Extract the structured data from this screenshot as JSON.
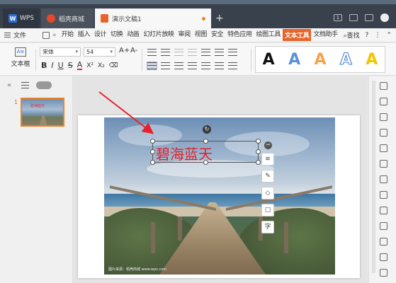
{
  "titlebar": {
    "tabs": [
      {
        "label": "WPS",
        "logo": "W"
      },
      {
        "label": "稻壳商城"
      },
      {
        "label": "演示文稿1"
      }
    ],
    "badge": "1",
    "new_tab": "+"
  },
  "menubar": {
    "file_label": "文件",
    "more": "»",
    "items": [
      "开始",
      "插入",
      "设计",
      "切换",
      "动画",
      "幻灯片放映",
      "审阅",
      "视图",
      "安全",
      "特色应用",
      "绘图工具",
      "文本工具",
      "文档助手"
    ],
    "active_item": "文本工具",
    "search_label": "查找",
    "help": "?"
  },
  "ribbon": {
    "textbox_label": "文本框",
    "textbox_icon": "A≡",
    "font": "宋体",
    "size": "54",
    "grow": "A+",
    "shrink": "A-",
    "format": {
      "bold": "B",
      "italic": "I",
      "underline": "U",
      "strike": "S",
      "color": "A",
      "super": "X²",
      "sub": "X₂",
      "clear": "⌫"
    },
    "style_letters": [
      "A",
      "A",
      "A",
      "A",
      "A"
    ],
    "colors": {
      "accent": "#e8642a",
      "text_red": "#e0212a"
    }
  },
  "left_panel": {
    "slide_number": "1",
    "thumb_title": "碧海蓝天",
    "collapse": "«"
  },
  "slide": {
    "title_text": "碧海蓝天",
    "watermark": "图片来源：稻壳商城  www.wps.com"
  },
  "float_toolbar": {
    "minus": "−",
    "buttons": [
      "≋",
      "✎",
      "◇",
      "▢",
      "字"
    ]
  },
  "rotate_glyph": "↻"
}
